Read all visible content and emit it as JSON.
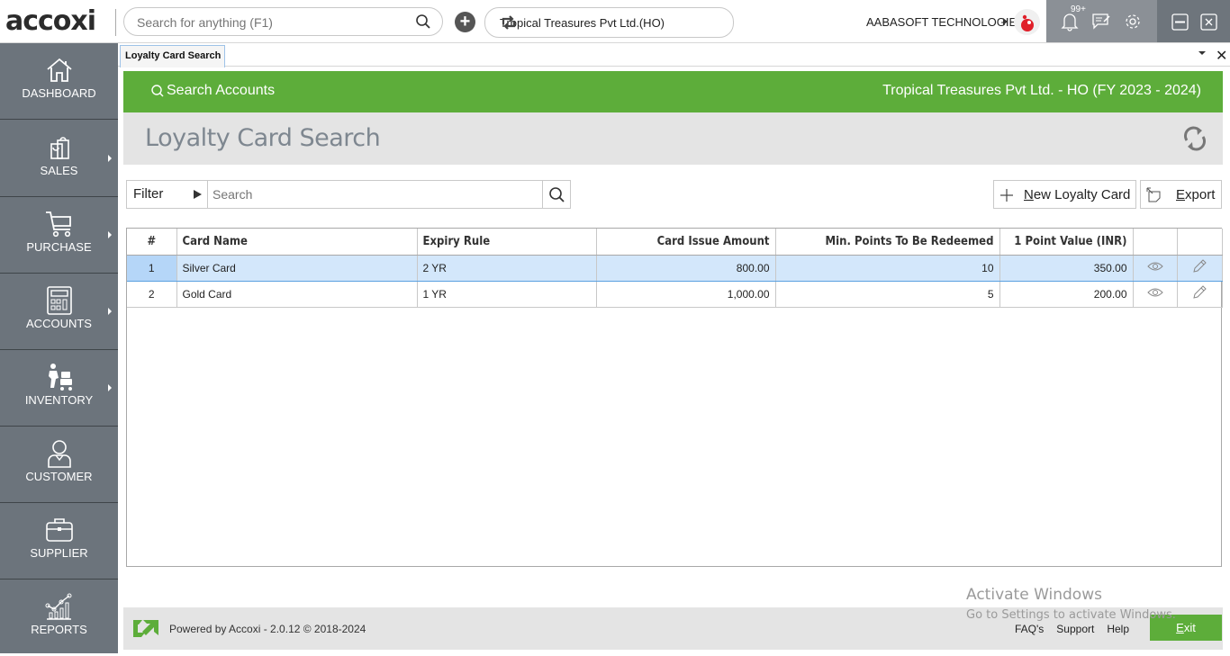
{
  "topbar": {
    "logo": "accoxi",
    "search_placeholder": "Search for anything (F1)",
    "company_selector": "Tropical Treasures Pvt Ltd.(HO)",
    "organization": "AABASOFT TECHNOLOGIES",
    "notification_badge": "99+"
  },
  "sidebar": {
    "items": [
      {
        "label": "DASHBOARD",
        "icon": "home-icon",
        "has_submenu": false
      },
      {
        "label": "SALES",
        "icon": "shopping-bag-icon",
        "has_submenu": true
      },
      {
        "label": "PURCHASE",
        "icon": "cart-icon",
        "has_submenu": true
      },
      {
        "label": "ACCOUNTS",
        "icon": "calculator-icon",
        "has_submenu": true
      },
      {
        "label": "INVENTORY",
        "icon": "trolley-icon",
        "has_submenu": true
      },
      {
        "label": "CUSTOMER",
        "icon": "person-icon",
        "has_submenu": false
      },
      {
        "label": "SUPPLIER",
        "icon": "briefcase-icon",
        "has_submenu": false
      },
      {
        "label": "REPORTS",
        "icon": "chart-icon",
        "has_submenu": false
      }
    ]
  },
  "tabs": [
    {
      "label": "Loyalty Card Search",
      "active": true
    }
  ],
  "header": {
    "search_accounts": "Search Accounts",
    "company_fy": "Tropical Treasures Pvt Ltd. - HO (FY 2023 - 2024)"
  },
  "page": {
    "title": "Loyalty Card Search"
  },
  "toolbar": {
    "filter_label": "Filter",
    "search_placeholder": "Search",
    "new_button_prefix": "N",
    "new_button_rest": "ew Loyalty Card",
    "export_prefix": "E",
    "export_rest": "xport"
  },
  "table": {
    "columns": [
      "#",
      "Card Name",
      "Expiry Rule",
      "Card Issue Amount",
      "Min. Points To Be Redeemed",
      "1 Point Value (INR)",
      "",
      ""
    ],
    "rows": [
      {
        "num": "1",
        "card_name": "Silver Card",
        "expiry_rule": "2 YR",
        "issue_amount": "800.00",
        "min_points": "10",
        "point_value": "350.00",
        "selected": true
      },
      {
        "num": "2",
        "card_name": "Gold Card",
        "expiry_rule": "1 YR",
        "issue_amount": "1,000.00",
        "min_points": "5",
        "point_value": "200.00",
        "selected": false
      }
    ]
  },
  "footer": {
    "powered": "Powered by Accoxi - 2.0.12 © 2018-2024",
    "links": [
      "FAQ's",
      "Support",
      "Help"
    ],
    "exit_prefix": "E",
    "exit_rest": "xit"
  },
  "watermark": {
    "line1": "Activate Windows",
    "line2": "Go to Settings to activate Windows."
  },
  "colors": {
    "accent_green": "#5dad3a",
    "sidebar": "#6c747c",
    "selected_row": "#d3e7fb"
  }
}
